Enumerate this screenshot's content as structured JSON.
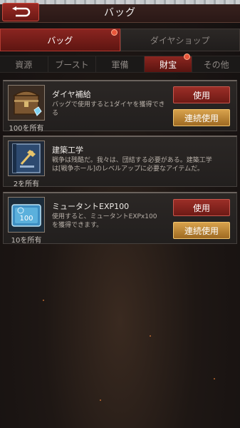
{
  "header": {
    "title": "バッグ"
  },
  "main_tabs": [
    {
      "label": "バッグ",
      "active": true,
      "badge": true
    },
    {
      "label": "ダイヤショップ",
      "active": false,
      "badge": false
    }
  ],
  "sub_tabs": [
    {
      "label": "資源",
      "active": false
    },
    {
      "label": "ブースト",
      "active": false
    },
    {
      "label": "軍備",
      "active": false
    },
    {
      "label": "財宝",
      "active": true,
      "badge": true
    },
    {
      "label": "その他",
      "active": false
    }
  ],
  "items": [
    {
      "name": "ダイヤ補給",
      "desc_line1": "バッグで使用すると1ダイヤを獲得でき",
      "desc_line2": "る",
      "owned": "100を所有",
      "use_label": "使用",
      "multi_label": "連続使用",
      "icon": "treasure-chest-icon"
    },
    {
      "name": "建築工学",
      "desc_line1": "戦争は残酷だ。我々は、団結する必要がある。建築工学",
      "desc_line2": "は[戦争ホール]のレベルアップに必要なアイテムだ。",
      "owned": "2を所有",
      "icon": "blueprint-book-icon"
    },
    {
      "name": "ミュータントEXP100",
      "desc_line1": "使用すると、ミュータントEXPx100",
      "desc_line2": "を獲得できます。",
      "owned": "10を所有",
      "use_label": "使用",
      "multi_label": "連続使用",
      "icon": "exp-card-icon",
      "icon_text": "100"
    }
  ]
}
